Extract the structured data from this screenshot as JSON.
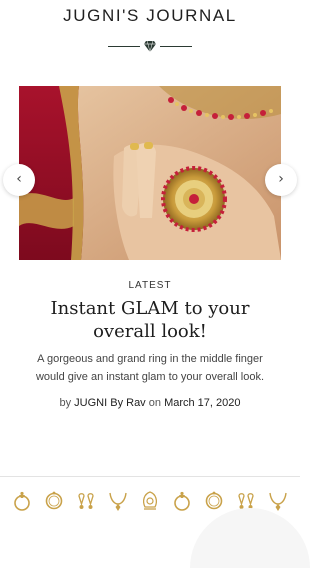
{
  "header": {
    "title": "JUGNI'S JOURNAL",
    "divider_icon": "diamond-icon",
    "accent_color": "#2b3a33"
  },
  "carousel": {
    "prev_icon": "chevron-left-icon",
    "next_icon": "chevron-right-icon",
    "prev_glyph": "‹",
    "next_glyph": "›"
  },
  "post": {
    "category": "LATEST",
    "title": "Instant GLAM to your overall look!",
    "excerpt": "A gorgeous and grand ring in the middle finger would give an instant glam to your overall look.",
    "byline_prefix": "by",
    "author": "JUGNI By Rav",
    "byline_on": "on",
    "date": "March 17, 2020"
  },
  "footer": {
    "icons": [
      "ring-icon",
      "bangle-icon",
      "earring-icon",
      "necklace-icon",
      "maang-tikka-icon",
      "ring-icon",
      "bangle-icon",
      "earring-icon",
      "necklace-icon"
    ],
    "gold_color": "#c9a24a"
  }
}
